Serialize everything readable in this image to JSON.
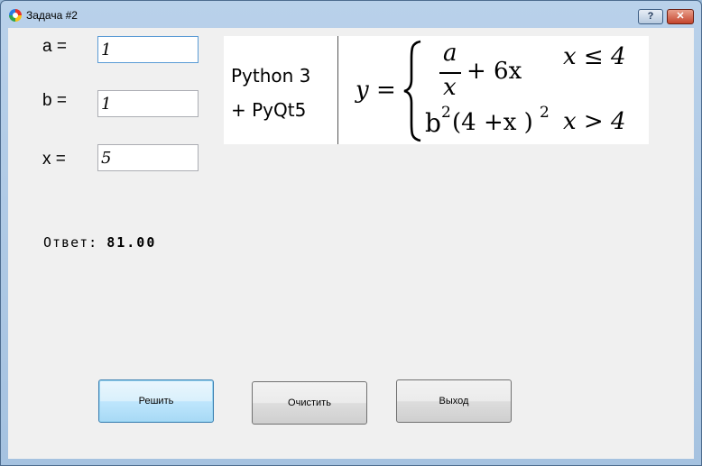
{
  "window": {
    "title": "Задача #2",
    "help_label": "?",
    "close_label": "✕"
  },
  "form": {
    "a": {
      "label": "a =",
      "value": "1"
    },
    "b": {
      "label": "b =",
      "value": "1"
    },
    "x": {
      "label": "x =",
      "value": "5"
    }
  },
  "formula_banner": {
    "line1": "Python 3",
    "line2": "+ PyQt5",
    "y_eq": "y =",
    "case1_num": "a",
    "case1_den": "x",
    "case1_rest": "+ 6x",
    "case1_cond": "x ≤ 4",
    "case2_b": "b",
    "case2_exp1": "2",
    "case2_mid": "(4 +x )",
    "case2_exp2": "2",
    "case2_cond": "x > 4"
  },
  "answer": {
    "label": "Ответ:",
    "value": "81.00"
  },
  "buttons": {
    "solve": "Решить",
    "clear": "Очистить",
    "exit": "Выход"
  }
}
